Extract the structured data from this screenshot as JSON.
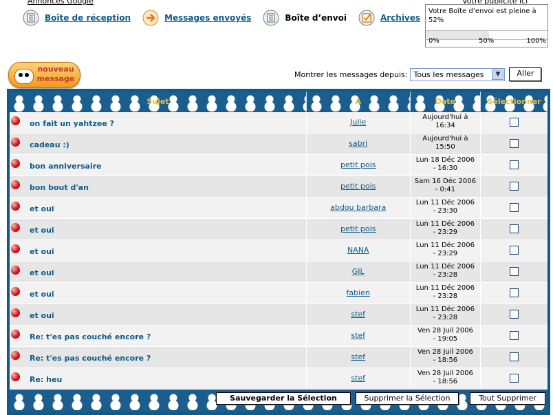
{
  "top_cut": {
    "left_text": "Annonces Google",
    "right_text": "Votre publicité ici"
  },
  "nav": {
    "inbox": "Boîte de réception",
    "sent": "Messages envoyés",
    "outbox": "Boîte d’envoi",
    "archives": "Archives"
  },
  "quota": {
    "text": "Votre Boîte d’envoi est pleine à 52%",
    "percent": 52,
    "label_0": "0%",
    "label_50": "50%",
    "label_100": "100%"
  },
  "new_message": {
    "line1": "nouveau",
    "line2": "message"
  },
  "filter": {
    "label": "Montrer les messages depuis:",
    "selected": "Tous les messages",
    "go": "Aller"
  },
  "table": {
    "headers": {
      "subject": "Sujet",
      "from": "A",
      "date": "Date",
      "select": "Sélectionner"
    },
    "rows": [
      {
        "subject": "on fait un yahtzee ?",
        "from": "Julie",
        "date1": "Aujourd'hui à",
        "date2": "16:34"
      },
      {
        "subject": "cadeau :)",
        "from": "sabri",
        "date1": "Aujourd'hui à",
        "date2": "15:50"
      },
      {
        "subject": "bon anniversaire",
        "from": "petit pois",
        "date1": "Lun 18 Déc 2006",
        "date2": "- 16:30"
      },
      {
        "subject": "bon bout d'an",
        "from": "petit pois",
        "date1": "Sam 16 Déc 2006",
        "date2": "- 0:41"
      },
      {
        "subject": "et oui",
        "from": "abdou barbara",
        "date1": "Lun 11 Déc 2006",
        "date2": "- 23:30"
      },
      {
        "subject": "et oui",
        "from": "petit pois",
        "date1": "Lun 11 Déc 2006",
        "date2": "- 23:29"
      },
      {
        "subject": "et oui",
        "from": "NANA",
        "date1": "Lun 11 Déc 2006",
        "date2": "- 23:29"
      },
      {
        "subject": "et oui",
        "from": "GIL",
        "date1": "Lun 11 Déc 2006",
        "date2": "- 23:28"
      },
      {
        "subject": "et oui",
        "from": "fabien",
        "date1": "Lun 11 Déc 2006",
        "date2": "- 23:28"
      },
      {
        "subject": "et oui",
        "from": "stef",
        "date1": "Lun 11 Déc 2006",
        "date2": "- 23:28"
      },
      {
        "subject": "Re: t'es pas couché encore ?",
        "from": "stef",
        "date1": "Ven 28 Juil 2006",
        "date2": "- 19:05"
      },
      {
        "subject": "Re: t'es pas couché encore ?",
        "from": "stef",
        "date1": "Ven 28 Juil 2006",
        "date2": "- 18:56"
      },
      {
        "subject": "Re: heu",
        "from": "stef",
        "date1": "Ven 28 Juil 2006",
        "date2": "- 18:56"
      }
    ]
  },
  "actions": {
    "save": "Sauvegarder la Sélection",
    "delete": "Supprimer la Sélection",
    "delete_all": "Tout Supprimer"
  },
  "colors": {
    "link": "#0e5b8a",
    "frame": "#0e5b8a",
    "header_text": "#f0c040",
    "unread_dot": "#d21010"
  }
}
